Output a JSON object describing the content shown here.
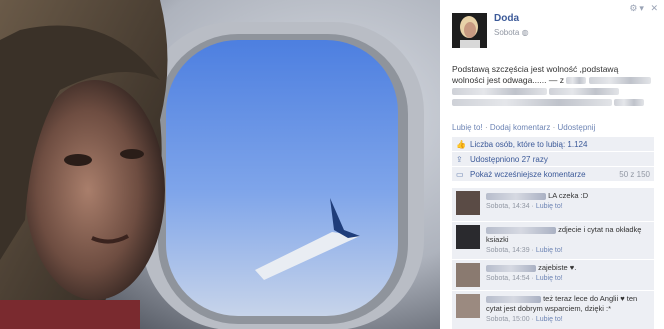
{
  "owner": {
    "name": "Doda",
    "date": "Sobota"
  },
  "post": {
    "caption": "Podstawą szczęścia jest wolność ,podstawą wolności jest odwaga...... — z"
  },
  "actions": {
    "like": "Lubię to!",
    "comment": "Dodaj komentarz",
    "share": "Udostępnij",
    "separator": "·"
  },
  "ufi": {
    "likes": "Liczba osób, które to lubią: 1.124",
    "shares": "Udostępniono 27 razy",
    "more_comments": "Pokaż wcześniejsze komentarze",
    "more_count": "50 z 150"
  },
  "comments": [
    {
      "text": "LA czeka :D",
      "time": "Sobota, 14:34",
      "like": "Lubię to!"
    },
    {
      "text": "zdjecie i cytat na okładkę ksiazki",
      "time": "Sobota, 14:39",
      "like": "Lubię to!"
    },
    {
      "text": "zajebiste ♥.",
      "time": "Sobota, 14:54",
      "like": "Lubię to!"
    },
    {
      "text": "też teraz lece do Anglii ♥ ten cytat jest dobrym wsparciem, dzięki :*",
      "time": "Sobota, 15:00",
      "like": "Lubię to!"
    }
  ],
  "icons": {
    "settings": "gear-icon",
    "close": "close-icon",
    "like": "thumbs-up-icon",
    "share": "share-icon",
    "comments": "comment-bubble-icon",
    "privacy": "globe-icon"
  }
}
